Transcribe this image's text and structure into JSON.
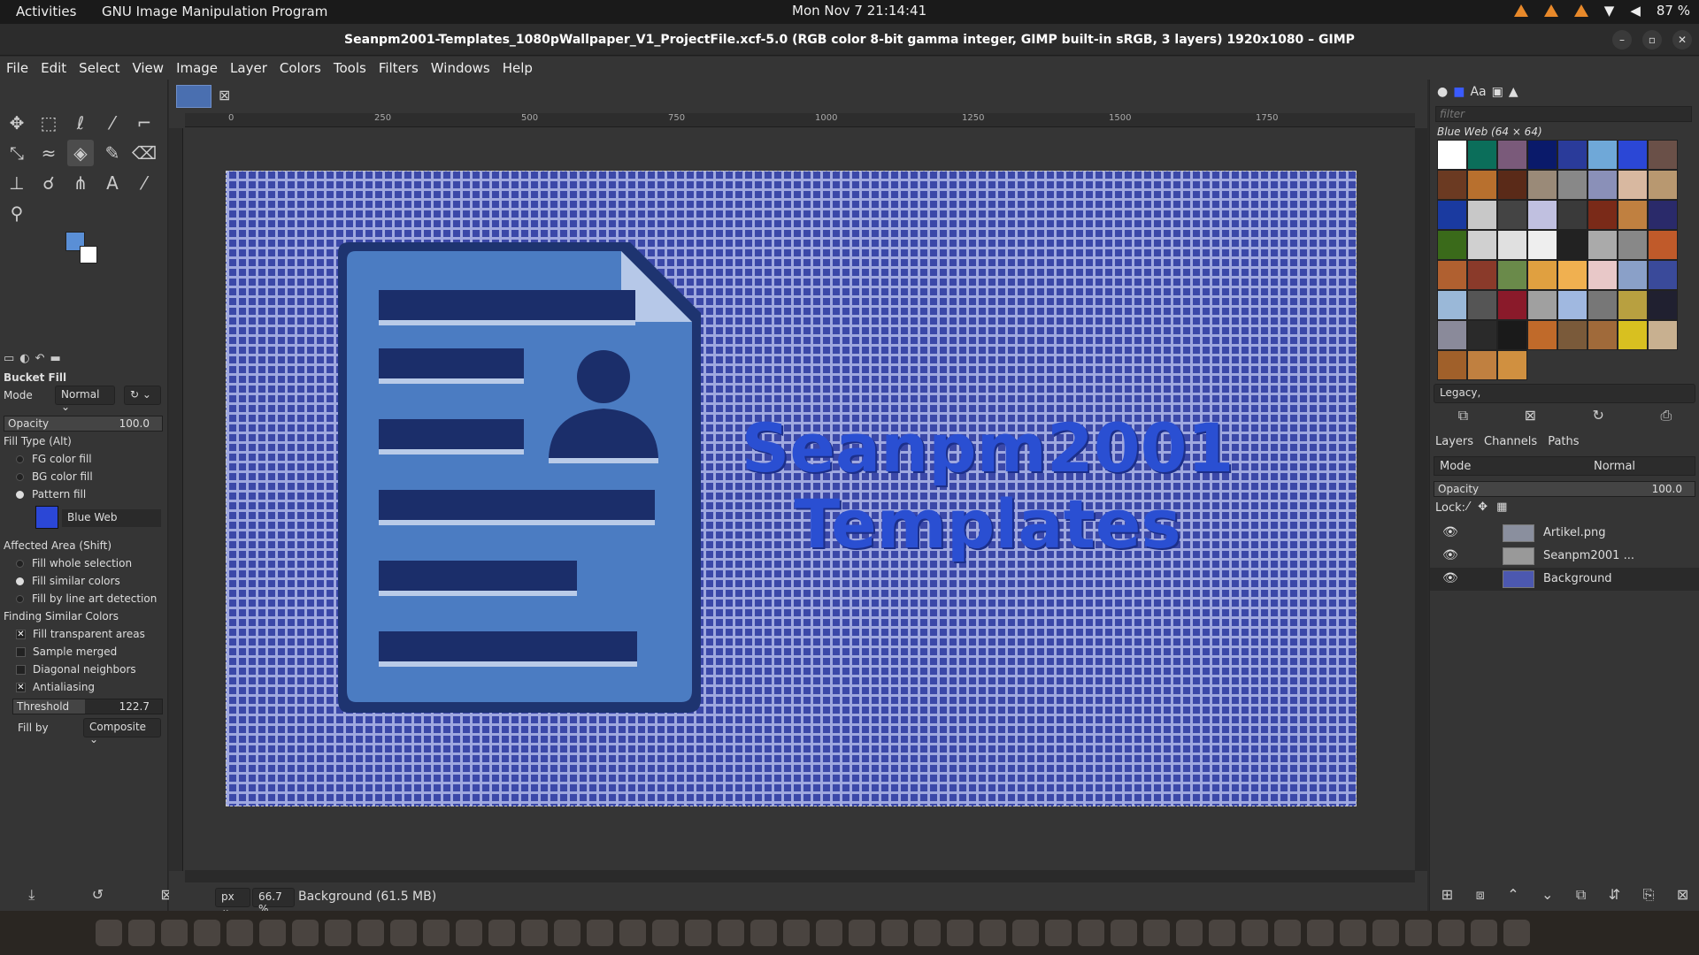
{
  "topbar": {
    "activities": "Activities",
    "app": "GNU Image Manipulation Program",
    "clock": "Mon Nov 7  21:14:41",
    "battery": "87 %"
  },
  "window": {
    "title": "Seanpm2001-Templates_1080pWallpaper_V1_ProjectFile.xcf-5.0 (RGB color 8-bit gamma integer, GIMP built-in sRGB, 3 layers) 1920x1080 – GIMP"
  },
  "menu": [
    "File",
    "Edit",
    "Select",
    "View",
    "Image",
    "Layer",
    "Colors",
    "Tools",
    "Filters",
    "Windows",
    "Help"
  ],
  "tool_options": {
    "title": "Bucket Fill",
    "mode_label": "Mode",
    "mode_value": "Normal",
    "opacity_label": "Opacity",
    "opacity_value": "100.0",
    "fill_type_label": "Fill Type  (Alt)",
    "fill_types": [
      "FG color fill",
      "BG color fill",
      "Pattern fill"
    ],
    "pattern_name": "Blue Web",
    "affected_label": "Affected Area  (Shift)",
    "affected": [
      "Fill whole selection",
      "Fill similar colors",
      "Fill by line art detection"
    ],
    "finding_label": "Finding Similar Colors",
    "finding": [
      "Fill transparent areas",
      "Sample merged",
      "Diagonal neighbors",
      "Antialiasing"
    ],
    "threshold_label": "Threshold",
    "threshold_value": "122.7",
    "fillby_label": "Fill by",
    "fillby_value": "Composite"
  },
  "ruler": [
    "0",
    "250",
    "500",
    "750",
    "1000",
    "1250",
    "1500",
    "1750"
  ],
  "canvas": {
    "headline1": "Seanpm2001",
    "headline2": "Templates"
  },
  "status": {
    "unit": "px",
    "zoom": "66.7 %",
    "info": "Background (61.5 MB)"
  },
  "patterns": {
    "filter_placeholder": "filter",
    "selected_label": "Blue Web (64 × 64)",
    "tag": "Legacy,"
  },
  "layers": {
    "tabs": [
      "Layers",
      "Channels",
      "Paths"
    ],
    "mode_label": "Mode",
    "mode_value": "Normal",
    "opacity_label": "Opacity",
    "opacity_value": "100.0",
    "lock_label": "Lock:",
    "items": [
      "Artikel.png",
      "Seanpm2001 ...",
      "Background"
    ]
  }
}
